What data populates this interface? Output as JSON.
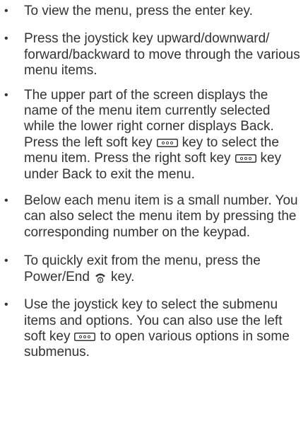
{
  "bullet_char": "•",
  "items": [
    {
      "t1": "To view the menu, press the enter key."
    },
    {
      "t1": "Press the joystick key upward/downward/ forward/backward to move through the various menu items."
    },
    {
      "t1": "The upper part of the screen displays the name of the menu item currently selected while the lower right corner displays Back. Press the left soft key",
      "t2": "key to select the menu item. Press the right soft  key",
      "t3": "key under Back to exit the menu."
    },
    {
      "t1": "Below each menu item is a small number. You can also select the menu item by pressing the corresponding number on the keypad."
    },
    {
      "t1": "To quickly exit from the menu, press the Power/End",
      "t2": "key."
    },
    {
      "t1": "Use the joystick key to select the submenu items and options. You can also use the left soft key",
      "t2": "to open various options in some submenus."
    }
  ]
}
